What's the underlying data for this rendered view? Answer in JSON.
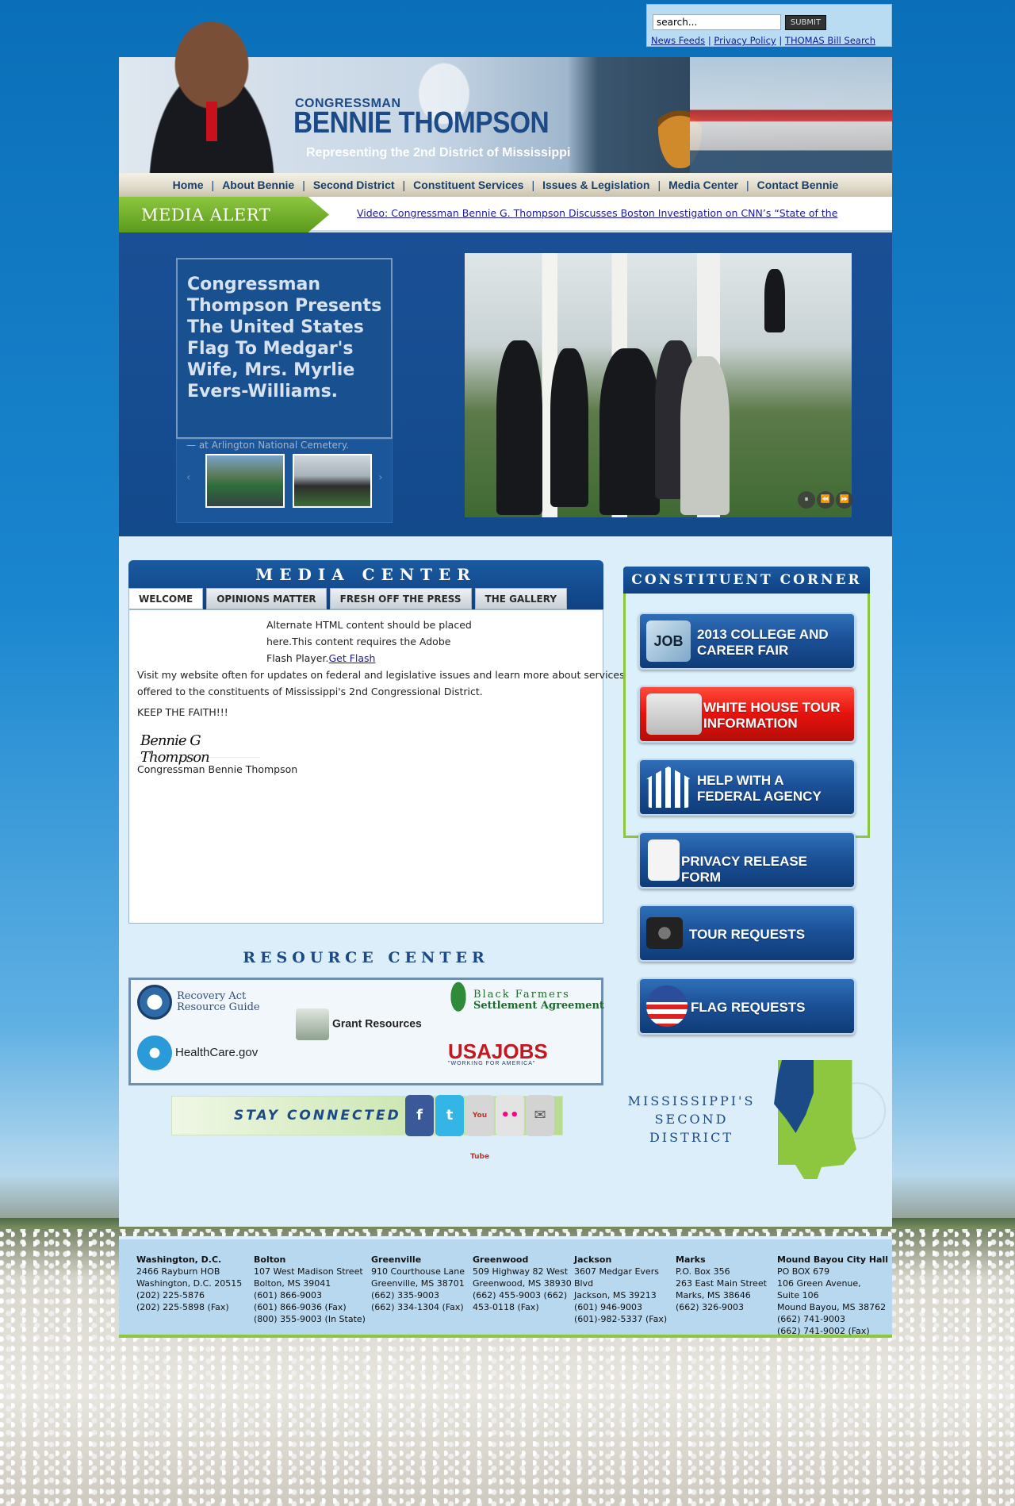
{
  "search": {
    "placeholder": "search...",
    "submit_label": "SUBMIT"
  },
  "top_links": [
    "News Feeds",
    "Privacy Policy",
    "THOMAS Bill Search"
  ],
  "header": {
    "prefix": "CONGRESSMAN",
    "name": "BENNIE THOMPSON",
    "tagline": "Representing the 2nd District of Mississippi"
  },
  "nav": [
    "Home",
    "About Bennie",
    "Second District",
    "Constituent Services",
    "Issues & Legislation",
    "Media Center",
    "Contact Bennie"
  ],
  "media_alert": {
    "label": "MEDIA ALERT",
    "link_text": "Video: Congressman Bennie G. Thompson Discusses Boston Investigation on CNN’s “State of the"
  },
  "feature": {
    "title": "Congressman Thompson Presents The United States Flag To Medgar's Wife, Mrs. Myrlie Evers-Williams.",
    "caption": "— at Arlington National Cemetery.",
    "controls": [
      "⏸",
      "⏪",
      "⏩"
    ]
  },
  "media_center": {
    "title": "MEDIA CENTER",
    "tabs": [
      "WELCOME",
      "OPINIONS MATTER",
      "FRESH OFF THE PRESS",
      "THE GALLERY"
    ],
    "flash_line1": "Alternate HTML content should be placed",
    "flash_line2": "here.This content requires the Adobe",
    "flash_line3": "Flash Player.",
    "flash_link": "Get Flash",
    "intro_line1": "Visit my website often for updates on federal and legislative issues and learn more about services",
    "intro_line2": "offered to the constituents of Mississippi's 2nd Congressional District.",
    "keep_faith": "KEEP THE FAITH!!!",
    "signature": "Bennie G Thompson",
    "signoff": "Congressman Bennie Thompson"
  },
  "resource_center": {
    "title": "RESOURCE CENTER",
    "items": {
      "recovery_line1": "Recovery Act",
      "recovery_line2": "Resource Guide",
      "grant": "Grant Resources",
      "farmers_line1": "Black Farmers",
      "farmers_line2": "Settlement Agreement",
      "healthcare": "HealthCare.gov",
      "usajobs": "USAJOBS",
      "usajobs_tag": "\"WORKING FOR AMERICA\""
    }
  },
  "stay_connected": {
    "label": "STAY CONNECTED",
    "icons": [
      "f",
      "t",
      "You Tube",
      "••",
      "✉"
    ]
  },
  "constituent_corner": {
    "title": "CONSTITUENT CORNER",
    "buttons": [
      {
        "line1": "2013 COLLEGE AND",
        "line2": "CAREER FAIR",
        "icon": "job-icon"
      },
      {
        "line1": "WHITE HOUSE TOUR",
        "line2": "INFORMATION",
        "icon": "white-house-icon"
      },
      {
        "line1": "HELP WITH A",
        "line2": "FEDERAL AGENCY",
        "icon": "government-building-icon"
      },
      {
        "line1": "PRIVACY RELEASE FORM",
        "line2": "",
        "icon": "document-icon"
      },
      {
        "line1": "TOUR REQUESTS",
        "line2": "",
        "icon": "camera-icon"
      },
      {
        "line1": "FLAG REQUESTS",
        "line2": "",
        "icon": "flag-icon"
      }
    ]
  },
  "district": {
    "line1": "MISSISSIPPI'S",
    "line2": "SECOND DISTRICT"
  },
  "offices": [
    {
      "city": "Washington, D.C.",
      "lines": [
        "2466 Rayburn HOB",
        "Washington, D.C. 20515",
        "(202) 225-5876",
        "(202) 225-5898 (Fax)"
      ]
    },
    {
      "city": "Bolton",
      "lines": [
        "107 West Madison Street",
        "Bolton, MS 39041",
        "(601) 866-9003",
        "(601) 866-9036 (Fax)",
        "(800) 355-9003 (In State)"
      ]
    },
    {
      "city": "Greenville",
      "lines": [
        "910 Courthouse Lane",
        "Greenville, MS 38701",
        "(662) 335-9003",
        "(662) 334-1304 (Fax)"
      ]
    },
    {
      "city": "Greenwood",
      "lines": [
        "509 Highway 82 West",
        "Greenwood, MS 38930",
        "(662) 455-9003 (662)",
        "453-0118 (Fax)"
      ]
    },
    {
      "city": "Jackson",
      "lines": [
        "3607 Medgar Evers",
        "Blvd",
        "Jackson, MS 39213",
        "(601) 946-9003",
        "(601)-982-5337 (Fax)"
      ]
    },
    {
      "city": "Marks",
      "lines": [
        "P.O. Box 356",
        "263 East Main Street",
        "Marks, MS 38646",
        "(662) 326-9003"
      ]
    },
    {
      "city": "Mound Bayou City Hall",
      "lines": [
        "PO BOX 679",
        "106 Green Avenue,",
        "Suite 106",
        "Mound Bayou, MS 38762",
        "(662) 741-9003",
        "(662) 741-9002 (Fax)"
      ]
    }
  ]
}
